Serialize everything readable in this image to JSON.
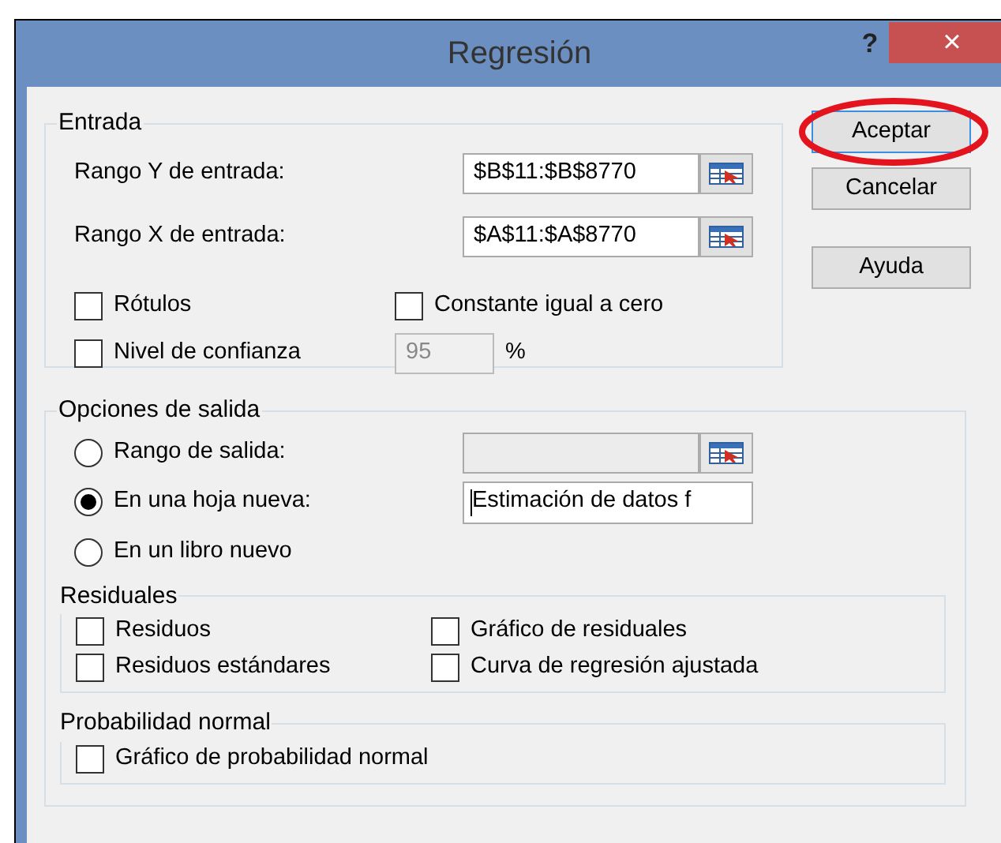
{
  "window": {
    "title": "Regresión",
    "help": "?",
    "close": "×"
  },
  "input": {
    "legend": "Entrada",
    "ranges": [
      {
        "label": "Rango Y de entrada:",
        "value": "$B$11:$B$8770"
      },
      {
        "label": "Rango X de entrada:",
        "value": "$A$11:$A$8770"
      }
    ],
    "options": [
      {
        "label": "Rótulos",
        "checked": false
      },
      {
        "label": "Constante igual a cero",
        "checked": false
      },
      {
        "label": "Nivel de confianza",
        "checked": false
      }
    ],
    "confidence": {
      "value": "95",
      "unit": "%",
      "disabled": true
    }
  },
  "buttons": [
    {
      "label": "Aceptar",
      "focused": true,
      "circled": true
    },
    {
      "label": "Cancelar",
      "focused": false,
      "circled": false
    },
    {
      "label": "Ayuda",
      "focused": false,
      "circled": false
    }
  ],
  "output": {
    "legend": "Opciones de salida",
    "choices": [
      {
        "kind": "range",
        "label": "Rango de salida:",
        "selected": false,
        "field_disabled": true
      },
      {
        "kind": "text",
        "label": "En una hoja nueva:",
        "selected": true,
        "value": "Estimación de datos f"
      },
      {
        "kind": "plain",
        "label": "En un libro nuevo",
        "selected": false
      }
    ],
    "residuals": {
      "legend": "Residuales",
      "items": [
        {
          "label": "Residuos",
          "checked": false
        },
        {
          "label": "Gráfico de residuales",
          "checked": false
        },
        {
          "label": "Residuos estándares",
          "checked": false
        },
        {
          "label": "Curva de regresión ajustada",
          "checked": false
        }
      ]
    },
    "normal": {
      "legend": "Probabilidad normal",
      "items": [
        {
          "label": "Gráfico de probabilidad normal",
          "checked": false
        }
      ]
    }
  }
}
